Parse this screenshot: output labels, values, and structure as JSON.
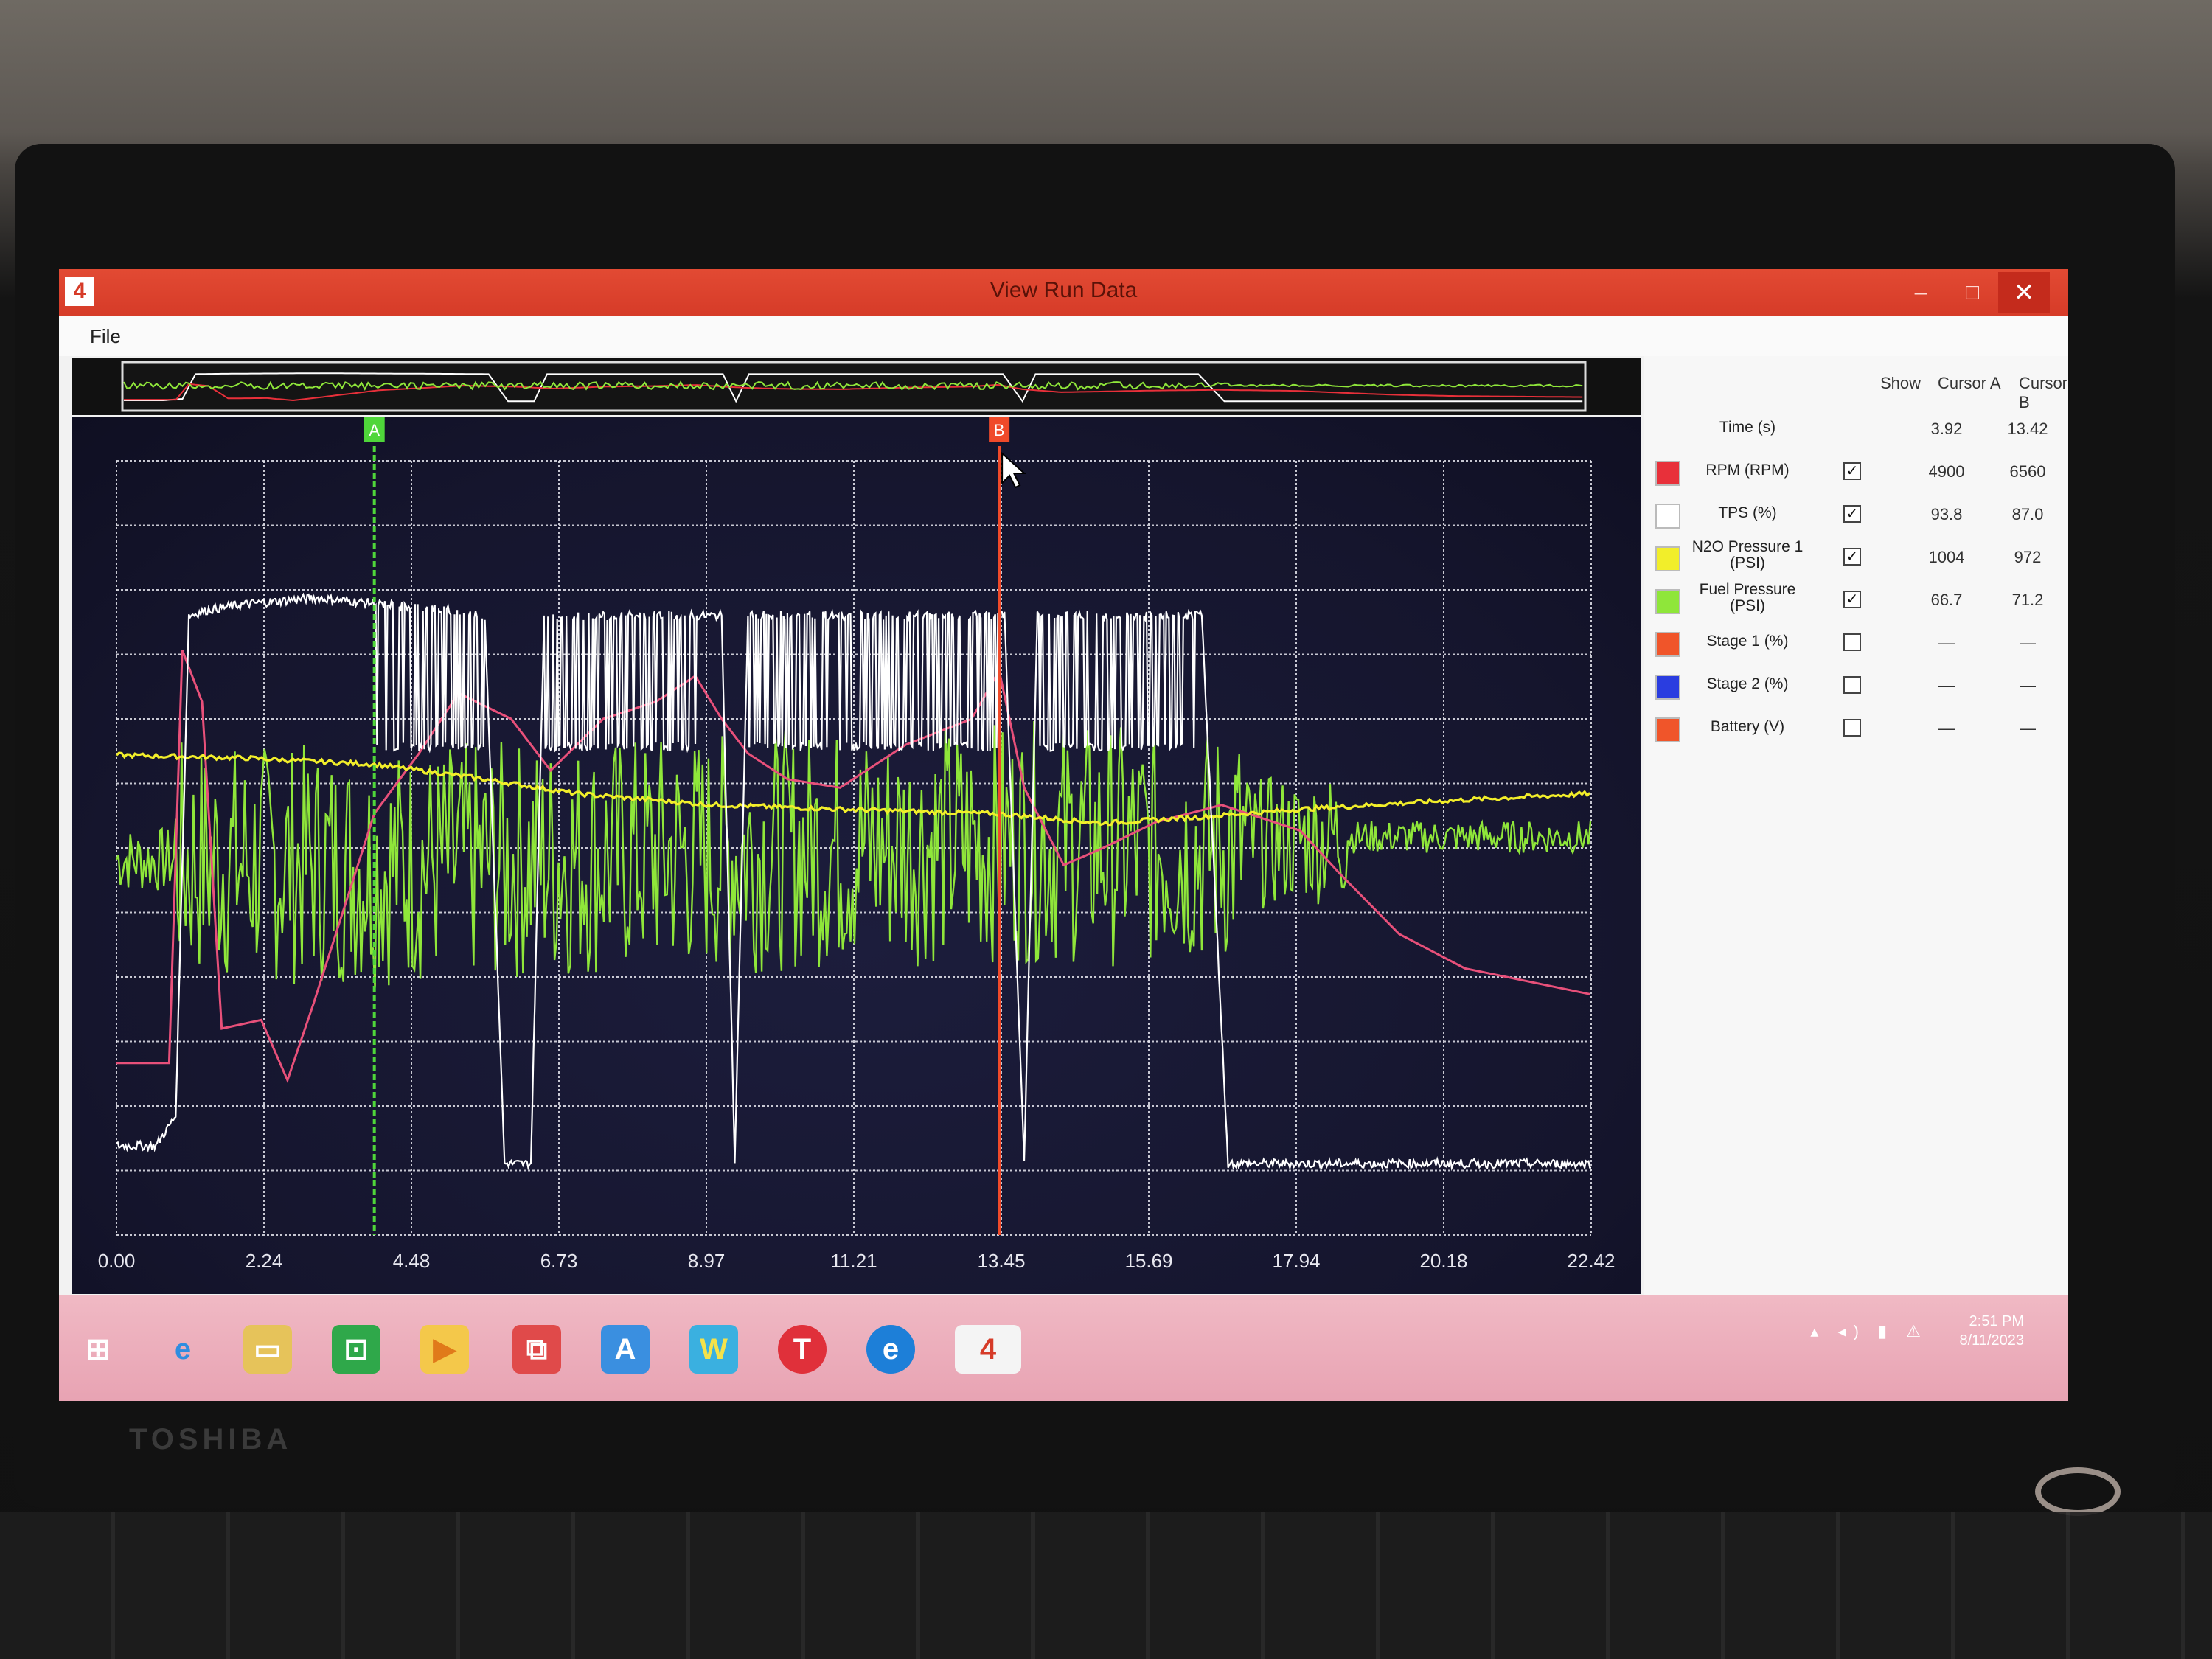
{
  "window": {
    "title": "View Run Data",
    "minimize": "–",
    "maximize": "□",
    "close": "✕"
  },
  "menu": {
    "file": "File"
  },
  "panel": {
    "headers": {
      "show": "Show",
      "cursor_a": "Cursor A",
      "cursor_b": "Cursor B"
    },
    "time": {
      "label": "Time (s)",
      "a": "3.92",
      "b": "13.42"
    },
    "channels": [
      {
        "label": "RPM (RPM)",
        "color": "#e8303a",
        "show": true,
        "a": "4900",
        "b": "6560"
      },
      {
        "label": "TPS (%)",
        "color": "#ffffff",
        "show": true,
        "a": "93.8",
        "b": "87.0"
      },
      {
        "label": "N2O Pressure 1 (PSI)",
        "color": "#f2ee2a",
        "show": true,
        "a": "1004",
        "b": "972"
      },
      {
        "label": "Fuel Pressure (PSI)",
        "color": "#8fe63a",
        "show": true,
        "a": "66.7",
        "b": "71.2"
      },
      {
        "label": "Stage 1 (%)",
        "color": "#f0552a",
        "show": false,
        "a": "—",
        "b": "—"
      },
      {
        "label": "Stage 2 (%)",
        "color": "#2a3de0",
        "show": false,
        "a": "—",
        "b": "—"
      },
      {
        "label": "Battery (V)",
        "color": "#f0552a",
        "show": false,
        "a": "—",
        "b": "—"
      }
    ]
  },
  "chart_data": {
    "type": "line",
    "xlabel": "",
    "ylabel": "",
    "x_ticks": [
      "0.00",
      "2.24",
      "4.48",
      "6.73",
      "8.97",
      "11.21",
      "13.45",
      "15.69",
      "17.94",
      "20.18",
      "22.42"
    ],
    "xlim": [
      0,
      22.42
    ],
    "cursors": [
      {
        "name": "A",
        "x": 3.92,
        "color": "#4fd63a"
      },
      {
        "name": "B",
        "x": 13.42,
        "color": "#f04a2a"
      }
    ],
    "series": [
      {
        "name": "TPS (%)",
        "color": "#ffffff",
        "x": [
          0,
          0.6,
          0.9,
          1.1,
          1.4,
          2.0,
          3.0,
          4.0,
          5.0,
          5.6,
          5.9,
          6.3,
          6.5,
          9.2,
          9.4,
          9.6,
          13.5,
          13.8,
          14.0,
          16.5,
          16.9,
          20.0,
          22.4
        ],
        "values": [
          5,
          5,
          10,
          94,
          95,
          96,
          97,
          96,
          95,
          94,
          2,
          2,
          94,
          94,
          2,
          94,
          94,
          2,
          94,
          94,
          2,
          2,
          2
        ]
      },
      {
        "name": "RPM (RPM)",
        "color": "#e8507a",
        "x": [
          0,
          0.8,
          1.0,
          1.3,
          1.6,
          2.2,
          2.6,
          3.0,
          3.92,
          4.6,
          5.2,
          6.0,
          6.6,
          7.4,
          8.2,
          8.8,
          9.2,
          9.6,
          10.2,
          11.0,
          12.0,
          13.0,
          13.42,
          13.8,
          14.4,
          15.0,
          15.8,
          16.8,
          18.0,
          18.6,
          19.5,
          20.5,
          22.4
        ],
        "values": [
          2000,
          2000,
          6800,
          6200,
          2400,
          2500,
          1800,
          2700,
          4900,
          5600,
          6300,
          6000,
          5400,
          6000,
          6200,
          6500,
          6000,
          5600,
          5300,
          5200,
          5700,
          6000,
          6560,
          5200,
          4300,
          4500,
          4800,
          5000,
          4700,
          4200,
          3500,
          3100,
          2800
        ]
      },
      {
        "name": "N2O Pressure 1 (PSI)",
        "color": "#f2ee2a",
        "x": [
          0,
          2.0,
          3.92,
          5.5,
          7.0,
          9.0,
          11.0,
          13.42,
          15.0,
          16.5,
          18.0,
          20.0,
          22.4
        ],
        "values": [
          1010,
          1008,
          1004,
          995,
          985,
          978,
          975,
          972,
          966,
          970,
          975,
          980,
          985
        ]
      },
      {
        "name": "Fuel Pressure (PSI)",
        "color": "#8fe63a",
        "x": [
          0,
          3.92,
          13.42,
          16.5,
          18.5,
          22.4
        ],
        "values": [
          68,
          66.7,
          71.2,
          70,
          72,
          72
        ]
      }
    ]
  },
  "taskbar": {
    "icons": [
      "windows-start-icon",
      "internet-explorer-icon",
      "file-explorer-icon",
      "store-icon",
      "media-player-icon",
      "toolbox-icon",
      "app-a-icon",
      "app-w-icon",
      "app-t-icon",
      "edge-icon",
      "run-data-app-icon"
    ],
    "clock_time": "2:51 PM",
    "clock_date": "8/11/2023"
  }
}
